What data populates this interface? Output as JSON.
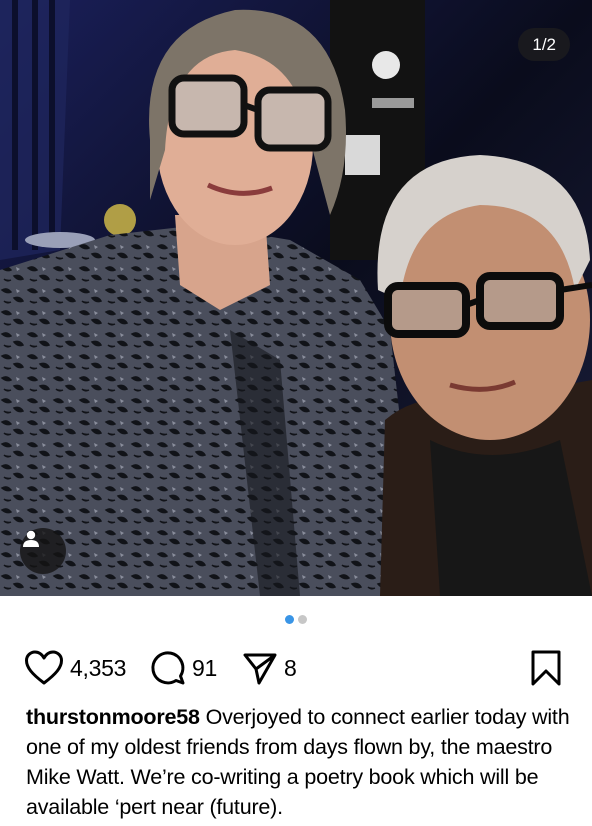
{
  "post": {
    "page_counter": "1/2",
    "carousel_total": 2,
    "carousel_active": 1,
    "likes": "4,353",
    "comments": "91",
    "shares": "8",
    "username": "thurstonmoore58",
    "caption": "Overjoyed to connect earlier today with one of my oldest friends from days flown by, the maestro Mike Watt. We’re co-writing a poetry book which will be available ‘pert near (future)."
  },
  "icons": {
    "like": "heart-icon",
    "comment": "comment-bubble-icon",
    "share": "paper-plane-icon",
    "save": "bookmark-icon",
    "tag": "person-icon"
  },
  "colors": {
    "dot_active": "#3a95e6",
    "dot_inactive": "#c7c7c7",
    "counter_bg": "#1c1c1e"
  }
}
